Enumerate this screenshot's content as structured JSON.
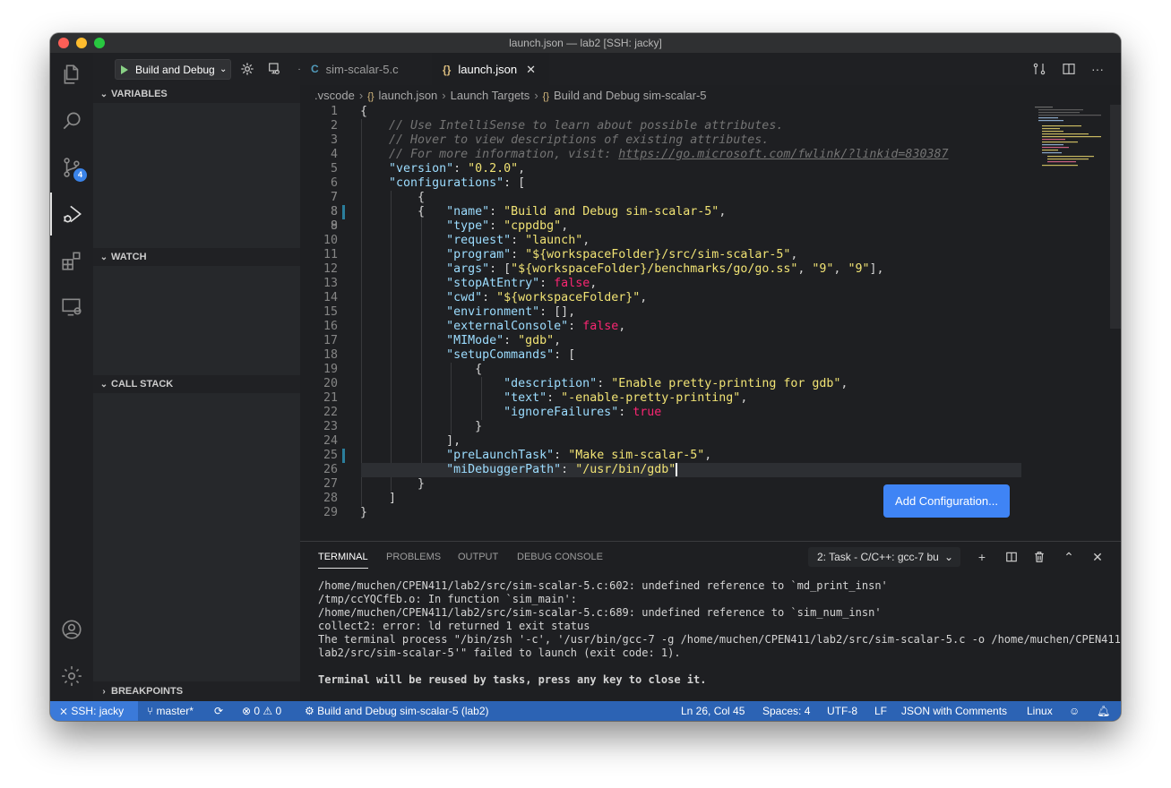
{
  "window": {
    "title": "launch.json — lab2 [SSH: jacky]"
  },
  "activity_bar": {
    "items": [
      "files-icon",
      "search-icon",
      "source-control-icon",
      "run-debug-icon",
      "extensions-icon",
      "remote-explorer-icon"
    ],
    "source_control_badge": "4",
    "bottom": [
      "account-icon",
      "settings-gear-icon"
    ]
  },
  "debug": {
    "launch_config": "Build and Debug sim-scalar-5",
    "sections": {
      "variables": "VARIABLES",
      "watch": "WATCH",
      "call_stack": "CALL STACK",
      "breakpoints": "BREAKPOINTS"
    }
  },
  "tabs": [
    {
      "label": "sim-scalar-5.c",
      "icon": "C",
      "active": false
    },
    {
      "label": "launch.json",
      "icon": "{}",
      "active": true
    }
  ],
  "breadcrumb": [
    ".vscode",
    "launch.json",
    "Launch Targets",
    "Build and Debug sim-scalar-5"
  ],
  "editor": {
    "line_numbers": [
      "1",
      "2",
      "3",
      "4",
      "5",
      "6",
      "7",
      "8",
      "9",
      "10",
      "11",
      "12",
      "13",
      "14",
      "15",
      "16",
      "17",
      "18",
      "19",
      "20",
      "21",
      "22",
      "23",
      "24",
      "25",
      "26",
      "27",
      "28",
      "29"
    ],
    "add_configuration_label": "Add Configuration...",
    "cursor_line": "26",
    "modified_lines": [
      "8",
      "25"
    ],
    "lines": {
      "l1": {
        "p": "{"
      },
      "l2": {
        "c": "// Use IntelliSense to learn about possible attributes."
      },
      "l3": {
        "c": "// Hover to view descriptions of existing attributes."
      },
      "l4": {
        "c": "// For more information, visit: ",
        "url": "https://go.microsoft.com/fwlink/?linkid=830387"
      },
      "l5": {
        "k": "\"version\"",
        "p1": ": ",
        "s": "\"0.2.0\"",
        "p2": ","
      },
      "l6": {
        "k": "\"configurations\"",
        "p1": ": ["
      },
      "l7": {
        "p": "{"
      },
      "l8": {
        "k": "\"name\"",
        "p1": ": ",
        "s": "\"Build and Debug sim-scalar-5\"",
        "p2": ","
      },
      "l9": {
        "k": "\"type\"",
        "p1": ": ",
        "s": "\"cppdbg\"",
        "p2": ","
      },
      "l10": {
        "k": "\"request\"",
        "p1": ": ",
        "s": "\"launch\"",
        "p2": ","
      },
      "l11": {
        "k": "\"program\"",
        "p1": ": ",
        "s": "\"${workspaceFolder}/src/sim-scalar-5\"",
        "p2": ","
      },
      "l12": {
        "k": "\"args\"",
        "p1": ": [",
        "s1": "\"${workspaceFolder}/benchmarks/go/go.ss\"",
        "p2": ", ",
        "s2": "\"9\"",
        "p3": ", ",
        "s3": "\"9\"",
        "p4": "],"
      },
      "l13": {
        "k": "\"stopAtEntry\"",
        "p1": ": ",
        "b": "false",
        "p2": ","
      },
      "l14": {
        "k": "\"cwd\"",
        "p1": ": ",
        "s": "\"${workspaceFolder}\"",
        "p2": ","
      },
      "l15": {
        "k": "\"environment\"",
        "p1": ": [],"
      },
      "l16": {
        "k": "\"externalConsole\"",
        "p1": ": ",
        "b": "false",
        "p2": ","
      },
      "l17": {
        "k": "\"MIMode\"",
        "p1": ": ",
        "s": "\"gdb\"",
        "p2": ","
      },
      "l18": {
        "k": "\"setupCommands\"",
        "p1": ": ["
      },
      "l19": {
        "p": "{"
      },
      "l20": {
        "k": "\"description\"",
        "p1": ": ",
        "s": "\"Enable pretty-printing for gdb\"",
        "p2": ","
      },
      "l21": {
        "k": "\"text\"",
        "p1": ": ",
        "s": "\"-enable-pretty-printing\"",
        "p2": ","
      },
      "l22": {
        "k": "\"ignoreFailures\"",
        "p1": ": ",
        "b": "true"
      },
      "l23": {
        "p": "}"
      },
      "l24": {
        "p": "],"
      },
      "l25": {
        "k": "\"preLaunchTask\"",
        "p1": ": ",
        "s": "\"Make sim-scalar-5\"",
        "p2": ","
      },
      "l26": {
        "k": "\"miDebuggerPath\"",
        "p1": ": ",
        "s": "\"/usr/bin/gdb\""
      },
      "l27": {
        "p": "}"
      },
      "l28": {
        "p": "]"
      },
      "l29": {
        "p": "}"
      }
    }
  },
  "panel": {
    "tabs": [
      "TERMINAL",
      "PROBLEMS",
      "OUTPUT",
      "DEBUG CONSOLE"
    ],
    "active_tab": "TERMINAL",
    "terminal_select": "2: Task - C/C++: gcc-7 bu",
    "terminal_lines": [
      "/home/muchen/CPEN411/lab2/src/sim-scalar-5.c:602: undefined reference to `md_print_insn'",
      "/tmp/ccYQCfEb.o: In function `sim_main':",
      "/home/muchen/CPEN411/lab2/src/sim-scalar-5.c:689: undefined reference to `sim_num_insn'",
      "collect2: error: ld returned 1 exit status",
      "The terminal process \"/bin/zsh '-c', '/usr/bin/gcc-7 -g /home/muchen/CPEN411/lab2/src/sim-scalar-5.c -o /home/muchen/CPEN411/",
      "lab2/src/sim-scalar-5'\" failed to launch (exit code: 1).",
      "",
      "Terminal will be reused by tasks, press any key to close it."
    ]
  },
  "statusbar": {
    "remote": "SSH: jacky",
    "branch": "master*",
    "errors": "0",
    "warnings": "0",
    "debug_target": "Build and Debug sim-scalar-5 (lab2)",
    "position": "Ln 26, Col 45",
    "spaces": "Spaces: 4",
    "encoding": "UTF-8",
    "eol": "LF",
    "language": "JSON with Comments",
    "os": "Linux"
  },
  "colors": {
    "statusbar": "#2c63b4",
    "remote": "#3b7ad9",
    "add_config_button": "#3f84f5",
    "json_key": "#9cdcfe",
    "json_string": "#f1e374",
    "json_bool": "#f92672",
    "comment": "#747474"
  }
}
